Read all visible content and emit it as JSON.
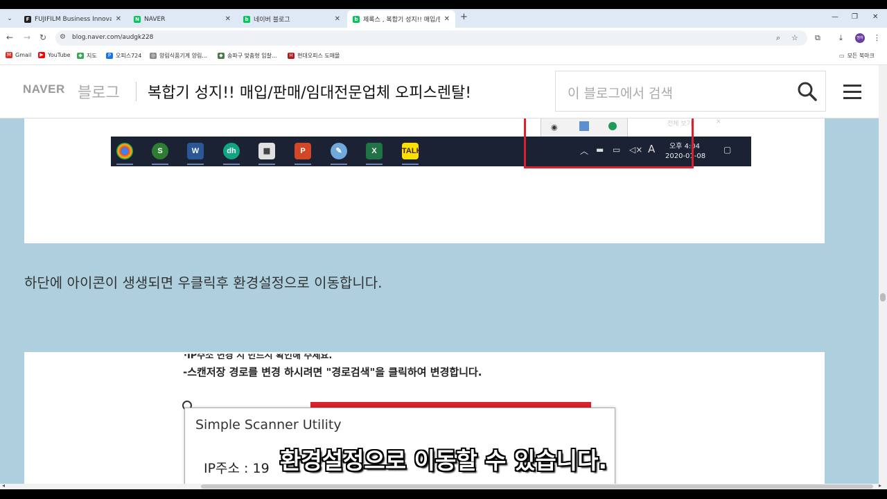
{
  "browser": {
    "tabs": [
      {
        "title": "FUJIFILM Business Innovation",
        "favicon": "F"
      },
      {
        "title": "NAVER",
        "favicon": "N"
      },
      {
        "title": "네이버 블로그",
        "favicon": "b"
      },
      {
        "title": "제록스 , 복합기 성지!! 매입/판",
        "favicon": "b"
      }
    ],
    "active_tab": 3,
    "new_tab_symbol": "+",
    "url": "blog.naver.com/audgk228",
    "profile_initials": "명하"
  },
  "bookmarks": [
    {
      "label": "Gmail",
      "icon": "M",
      "color": "#d93025"
    },
    {
      "label": "YouTube",
      "icon": "▶",
      "color": "#ff0000"
    },
    {
      "label": "지도",
      "icon": "◆",
      "color": "#34a853"
    },
    {
      "label": "오피스724",
      "icon": "P",
      "color": "#1a73e8"
    },
    {
      "label": "양림식품기계 양림...",
      "icon": "◎",
      "color": "#888888"
    },
    {
      "label": "송파구 맞춤형 입찰...",
      "icon": "◆",
      "color": "#4a7a4a"
    },
    {
      "label": "현대오피스 도매몰",
      "icon": "H",
      "color": "#b71c1c"
    }
  ],
  "all_bookmarks": "모든 북마크",
  "blog": {
    "naver": "NAVER",
    "blog_label": "블로그",
    "title": "복합기 성지!! 매입/판매/임대전문업체 오피스렌탈!",
    "search_placeholder": "이 블로그에서 검색"
  },
  "screenshot1": {
    "clock_top": "오후 4:04",
    "clock_bottom": "2020-01-08",
    "ime": "A",
    "popup_text": "전체 보기"
  },
  "body_text": "하단에 아이콘이 생생되면 우클릭후 환경설정으로 이동합니다.",
  "screenshot2": {
    "top_cut_text": "·IP주소 변경 시 반드시 확인해 주세요.",
    "instruction": "-스캔저장 경로를 변경 하시려면 \"경로검색\"을 클릭하여 변경합니다.",
    "dialog_title": "Simple Scanner Utility",
    "ip_label": "IP주소 :  19"
  },
  "subtitle": "환경설정으로 이동할 수 있습니다."
}
